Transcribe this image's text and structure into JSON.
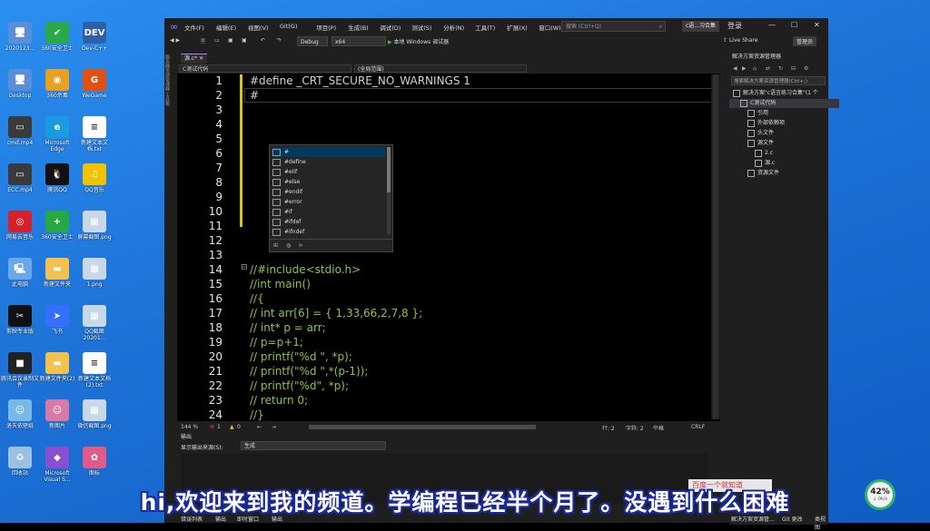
{
  "desktop": {
    "icons": [
      {
        "label": "2020123...",
        "glyph": "🖥",
        "color": "#5a8fd8"
      },
      {
        "label": "360安全卫士",
        "glyph": "✔",
        "color": "#2aa84a"
      },
      {
        "label": "Dev-C++",
        "glyph": "DEV",
        "color": "#2f5fa8"
      },
      {
        "label": "Desktop",
        "glyph": "🖥",
        "color": "#5a8fd8"
      },
      {
        "label": "360杀毒",
        "glyph": "◉",
        "color": "#e8a020"
      },
      {
        "label": "WeGame",
        "glyph": "G",
        "color": "#e05010"
      },
      {
        "label": "cmd.mp4",
        "glyph": "▭",
        "color": "#3a3a3a"
      },
      {
        "label": "Microsoft Edge",
        "glyph": "e",
        "color": "#1a9be0"
      },
      {
        "label": "新建文本文档.txt",
        "glyph": "≡",
        "color": "#ffffff"
      },
      {
        "label": "ECC.mp4",
        "glyph": "▭",
        "color": "#3a3a3a"
      },
      {
        "label": "腾讯QQ",
        "glyph": "🐧",
        "color": "#111111"
      },
      {
        "label": "QQ音乐",
        "glyph": "♫",
        "color": "#f2c200"
      },
      {
        "label": "网易云音乐",
        "glyph": "◎",
        "color": "#d8202a"
      },
      {
        "label": "360安全卫士",
        "glyph": "+",
        "color": "#28a745"
      },
      {
        "label": "屏幕截图.png",
        "glyph": "▦",
        "color": "#c8d8e8"
      },
      {
        "label": "此电脑",
        "glyph": "🖳",
        "color": "#6aa8e8"
      },
      {
        "label": "新建文件夹",
        "glyph": "▬",
        "color": "#f2c14e"
      },
      {
        "label": "1.png",
        "glyph": "▦",
        "color": "#c8d8e8"
      },
      {
        "label": "剪映专业版",
        "glyph": "✂",
        "color": "#111111"
      },
      {
        "label": "飞书",
        "glyph": "➤",
        "color": "#3370ff"
      },
      {
        "label": "QQ截图20201...",
        "glyph": "▦",
        "color": "#c8d8e8"
      },
      {
        "label": "腾讯会议录制文件",
        "glyph": "■",
        "color": "#222222"
      },
      {
        "label": "新建文件夹(2)",
        "glyph": "▬",
        "color": "#f2c14e"
      },
      {
        "label": "新建文本文档(2).txt",
        "glyph": "≡",
        "color": "#ffffff"
      },
      {
        "label": "洛天依壁纸",
        "glyph": "☺",
        "color": "#7ab8e8"
      },
      {
        "label": "新图片",
        "glyph": "☺",
        "color": "#d87aa8"
      },
      {
        "label": "微信截图.png",
        "glyph": "▦",
        "color": "#c8d8e8"
      },
      {
        "label": "回收站",
        "glyph": "♻",
        "color": "#9cc0e0"
      },
      {
        "label": "Microsoft Visual S...",
        "glyph": "◆",
        "color": "#8a4fcf"
      },
      {
        "label": "图标",
        "glyph": "✿",
        "color": "#e05a8a"
      }
    ]
  },
  "vs": {
    "menu": [
      "文件(F)",
      "编辑(E)",
      "视图(V)",
      "Git(G)",
      "项目(P)",
      "生成(B)",
      "调试(D)",
      "测试(S)",
      "分析(N)",
      "工具(T)",
      "扩展(X)",
      "窗口(W)",
      "帮助(H)"
    ],
    "search_placeholder": "搜索 (Ctrl+Q)",
    "project_badge": "c语...习合集",
    "win": {
      "min": "—",
      "max": "☐",
      "close": "✕",
      "account": "登录"
    },
    "toolbar": {
      "config": "Debug",
      "platform": "x64",
      "run": "本地 Windows 调试器",
      "live_share": "Live Share",
      "preview": "管理员"
    },
    "left_strip": "服务器资源管理器  工具箱",
    "tab": "源.c*",
    "tab_close": "✕",
    "nav_left": "C测试代码",
    "nav_right": "(全局范围)",
    "line_numbers": [
      "1",
      "2",
      "3",
      "4",
      "5",
      "6",
      "7",
      "8",
      "9",
      "10",
      "11",
      "12",
      "13",
      "14",
      "15",
      "16",
      "17",
      "18",
      "19",
      "20",
      "21",
      "22",
      "23",
      "24"
    ],
    "code_lines": [
      {
        "t": "#define _CRT_SECURE_NO_WARNINGS 1",
        "c": "mac"
      },
      {
        "t": "#",
        "c": "mac"
      },
      {
        "t": "",
        "c": "mac"
      },
      {
        "t": "",
        "c": "mac"
      },
      {
        "t": "",
        "c": "mac"
      },
      {
        "t": "",
        "c": "mac"
      },
      {
        "t": "",
        "c": "mac"
      },
      {
        "t": "",
        "c": "mac"
      },
      {
        "t": "",
        "c": "mac"
      },
      {
        "t": "",
        "c": "mac"
      },
      {
        "t": "",
        "c": "mac"
      },
      {
        "t": "",
        "c": "mac"
      },
      {
        "t": "",
        "c": "mac"
      },
      {
        "t": "//#include<stdio.h>",
        "c": "cm"
      },
      {
        "t": "//int main()",
        "c": "cm"
      },
      {
        "t": "//{",
        "c": "cm"
      },
      {
        "t": "// int arr[6] = { 1,33,66,2,7,8 };",
        "c": "cm"
      },
      {
        "t": "// int* p = arr;",
        "c": "cm"
      },
      {
        "t": "// p=p+1;",
        "c": "cm"
      },
      {
        "t": "// printf(\"%d \", *p);",
        "c": "cm"
      },
      {
        "t": "// printf(\"%d \",*(p-1));",
        "c": "cm"
      },
      {
        "t": "// printf(\"%d\", *p);",
        "c": "cm"
      },
      {
        "t": "// return 0;",
        "c": "cm"
      },
      {
        "t": "//}",
        "c": "cm"
      }
    ],
    "intellisense": [
      "#",
      "#define",
      "#elif",
      "#else",
      "#endif",
      "#error",
      "#if",
      "#ifdef",
      "#ifndef"
    ],
    "status": {
      "zoom": "144 %",
      "errors": "1",
      "warnings": "0",
      "line": "行: 2",
      "char": "字符: 2",
      "ws": "空格",
      "eol": "CRLF"
    },
    "output": {
      "title": "输出",
      "source_label": "显示输出来源(S):",
      "source": "生成"
    },
    "bottom_tabs": [
      "错误列表",
      "输出",
      "即时窗口",
      "输出"
    ],
    "solution": {
      "title": "解决方案资源管理器",
      "search": "搜索解决方案资源管理器(Ctrl+;)",
      "nodes": [
        {
          "label": "解决方案\"c语言练习合集\"(1 个",
          "indent": 0
        },
        {
          "label": "C测试代码",
          "indent": 1
        },
        {
          "label": "引用",
          "indent": 2
        },
        {
          "label": "外部依赖项",
          "indent": 2
        },
        {
          "label": "头文件",
          "indent": 2
        },
        {
          "label": "源文件",
          "indent": 2
        },
        {
          "label": "2.c",
          "indent": 3
        },
        {
          "label": "源.c",
          "indent": 3
        },
        {
          "label": "资源文件",
          "indent": 2
        }
      ],
      "tabs": [
        "解决方案资源管...",
        "Git 更改",
        "类视图"
      ]
    }
  },
  "overlay": {
    "subtitle": "hi,欢迎来到我的频道。学编程已经半个月了。没遇到什么困难",
    "gauge_value": "42%",
    "gauge_sub": "↓ 0k/s",
    "ad": "百度一个就知道"
  },
  "colors": {
    "comment": "#8cc24a",
    "accent": "#b17cff"
  }
}
